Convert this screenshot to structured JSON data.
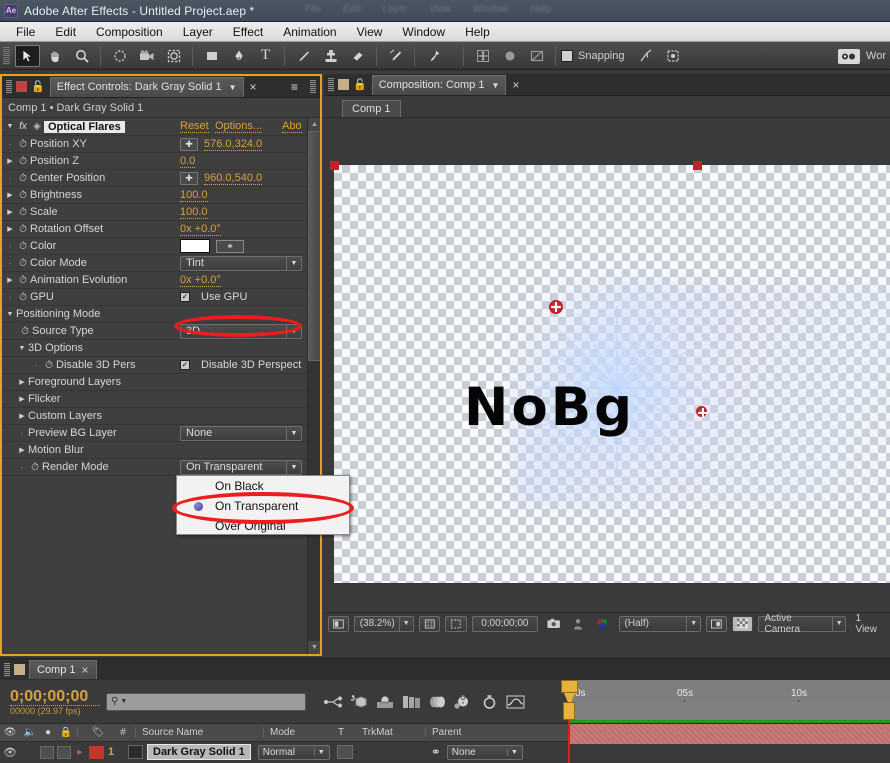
{
  "window": {
    "app_badge": "Ae",
    "title": "Adobe After Effects - Untitled Project.aep *",
    "ghost_menu": [
      "File",
      "Edit",
      "Composition",
      "Layer",
      "Effect",
      "Animation",
      "View",
      "Window",
      "Help"
    ]
  },
  "menubar": {
    "items": [
      "File",
      "Edit",
      "Composition",
      "Layer",
      "Effect",
      "Animation",
      "View",
      "Window",
      "Help"
    ]
  },
  "toolbar": {
    "tools": [
      {
        "name": "selection-tool",
        "glyph": "➤",
        "active": true
      },
      {
        "name": "hand-tool",
        "glyph": "✋",
        "active": false
      },
      {
        "name": "zoom-tool",
        "glyph": "⌕",
        "active": false
      },
      {
        "name": "rotation-tool",
        "glyph": "◌",
        "active": false
      },
      {
        "name": "camera-tool",
        "glyph": "🎥",
        "active": false
      },
      {
        "name": "pan-behind-tool",
        "glyph": "⬚",
        "active": false
      },
      {
        "name": "shape-tool",
        "glyph": "■",
        "active": false
      },
      {
        "name": "pen-tool",
        "glyph": "✒",
        "active": false
      },
      {
        "name": "text-tool",
        "glyph": "T",
        "active": false
      },
      {
        "name": "brush-tool",
        "glyph": "╱",
        "active": false
      },
      {
        "name": "clone-stamp-tool",
        "glyph": "⚓",
        "active": false
      },
      {
        "name": "eraser-tool",
        "glyph": "▱",
        "active": false
      },
      {
        "name": "roto-brush-tool",
        "glyph": "✒",
        "active": false
      },
      {
        "name": "puppet-pin-tool",
        "glyph": "📌",
        "active": false
      }
    ],
    "axis_tools": [
      {
        "name": "anchor-point-tool",
        "glyph": "✥"
      },
      {
        "name": "orbit-tool",
        "glyph": "●"
      },
      {
        "name": "track-camera-tool",
        "glyph": "◨"
      }
    ],
    "snapping_label": "Snapping",
    "snapping_checked": false,
    "snap_icons": [
      {
        "name": "snap-align-icon",
        "glyph": "↗"
      },
      {
        "name": "snap-bounds-icon",
        "glyph": "⧉"
      }
    ],
    "workspace_label": "Wor"
  },
  "effect_controls": {
    "tab_title": "Effect Controls: Dark Gray Solid 1",
    "close_glyph": "×",
    "menu_glyph": "≡",
    "breadcrumb": "Comp 1 • Dark Gray Solid 1",
    "effect_name": "Optical Flares",
    "header_links": [
      "Reset",
      "Options...",
      "Abo"
    ],
    "properties": [
      {
        "name": "Position XY",
        "type": "point",
        "value": "576.0,324.0",
        "indent": 0,
        "twirl": "none",
        "stopwatch": true
      },
      {
        "name": "Position Z",
        "type": "number",
        "value": "0.0",
        "indent": 0,
        "twirl": "closed",
        "stopwatch": true
      },
      {
        "name": "Center Position",
        "type": "point",
        "value": "960.0,540.0",
        "indent": 0,
        "twirl": "none",
        "stopwatch": true
      },
      {
        "name": "Brightness",
        "type": "number",
        "value": "100.0",
        "indent": 0,
        "twirl": "closed",
        "stopwatch": true
      },
      {
        "name": "Scale",
        "type": "number",
        "value": "100.0",
        "indent": 0,
        "twirl": "closed",
        "stopwatch": true
      },
      {
        "name": "Rotation Offset",
        "type": "number",
        "value": "0x +0.0°",
        "indent": 0,
        "twirl": "closed",
        "stopwatch": true
      },
      {
        "name": "Color",
        "type": "color",
        "value": "#ffffff",
        "indent": 0,
        "twirl": "none",
        "stopwatch": true
      },
      {
        "name": "Color Mode",
        "type": "dropdown",
        "value": "Tint",
        "indent": 0,
        "twirl": "none",
        "stopwatch": true
      },
      {
        "name": "Animation Evolution",
        "type": "number",
        "value": "0x +0.0°",
        "indent": 0,
        "twirl": "closed",
        "stopwatch": true
      },
      {
        "name": "GPU",
        "type": "checkbox",
        "value": "Use GPU",
        "checked": true,
        "indent": 0,
        "twirl": "none",
        "stopwatch": true
      },
      {
        "name": "Positioning Mode",
        "type": "group",
        "value": "",
        "indent": 0,
        "twirl": "open",
        "stopwatch": false
      },
      {
        "name": "Source Type",
        "type": "dropdown",
        "value": "3D",
        "indent": 1,
        "twirl": "none",
        "stopwatch": true,
        "highlighted": true
      },
      {
        "name": "3D Options",
        "type": "group",
        "value": "",
        "indent": 1,
        "twirl": "open",
        "stopwatch": false
      },
      {
        "name": "Disable 3D Pers",
        "type": "checkbox",
        "value": "Disable 3D Perspect",
        "checked": true,
        "indent": 2,
        "twirl": "none",
        "stopwatch": true
      },
      {
        "name": "Foreground Layers",
        "type": "group",
        "value": "",
        "indent": 0,
        "twirl": "closed",
        "stopwatch": false
      },
      {
        "name": "Flicker",
        "type": "group",
        "value": "",
        "indent": 0,
        "twirl": "closed",
        "stopwatch": false
      },
      {
        "name": "Custom Layers",
        "type": "group",
        "value": "",
        "indent": 0,
        "twirl": "closed",
        "stopwatch": false
      },
      {
        "name": "Preview BG Layer",
        "type": "dropdown",
        "value": "None",
        "indent": 0,
        "twirl": "none",
        "stopwatch": false
      },
      {
        "name": "Motion Blur",
        "type": "group",
        "value": "",
        "indent": 0,
        "twirl": "closed",
        "stopwatch": false
      },
      {
        "name": "Render Mode",
        "type": "dropdown",
        "value": "On Transparent",
        "indent": 0,
        "twirl": "none",
        "stopwatch": true
      }
    ]
  },
  "render_mode_popup": {
    "options": [
      "On Black",
      "On Transparent",
      "Over Original"
    ],
    "selected": "On Transparent"
  },
  "annotations": {
    "highlight_color": "#ee1c1c",
    "targets": [
      "source-type-dropdown",
      "render-mode-on-transparent-option"
    ]
  },
  "composition": {
    "tab_title": "Composition: Comp 1",
    "close_glyph": "×",
    "sub_tab": "Comp 1",
    "canvas_text": "NoBg",
    "bottom_bar": {
      "region_of_interest_icon": "▣",
      "zoom_level": "(38.2%)",
      "grid_icon": "⌗",
      "mask_icon": "⬚",
      "timecode": "0;00;00;00",
      "snapshot_icon": "📷",
      "show_snapshot_icon": "♟",
      "channel_icon": "◑",
      "resolution": "(Half)",
      "region_icon": "□",
      "transparency_grid_icon": "▒",
      "camera_view": "Active Camera",
      "view_layout": "1 View"
    }
  },
  "timeline": {
    "tab_title": "Comp 1",
    "close_glyph": "×",
    "current_time": "0;00;00;00",
    "frame_info": "00000 (29.97 fps)",
    "search_placeholder": "",
    "toolbar_icons": [
      {
        "name": "composition-mini-flowchart-icon",
        "glyph": "⇉"
      },
      {
        "name": "draft-3d-icon",
        "glyph": "⬡"
      },
      {
        "name": "hide-shy-layers-icon",
        "glyph": "☂"
      },
      {
        "name": "frame-blending-icon",
        "glyph": "▓"
      },
      {
        "name": "motion-blur-icon",
        "glyph": "◐"
      },
      {
        "name": "brainstorm-icon",
        "glyph": "☀"
      },
      {
        "name": "auto-keyframe-icon",
        "glyph": "⏱"
      },
      {
        "name": "graph-editor-icon",
        "glyph": "⌀"
      }
    ],
    "column_headers": [
      "#",
      "Source Name",
      "Mode",
      "T",
      "TrkMat",
      "Parent"
    ],
    "switch_icons": [
      {
        "name": "video-visibility-icon",
        "glyph": "◉"
      },
      {
        "name": "audio-icon",
        "glyph": "◄"
      },
      {
        "name": "solo-icon",
        "glyph": "●"
      },
      {
        "name": "lock-icon",
        "glyph": "🔒"
      },
      {
        "name": "label-icon",
        "glyph": "◆"
      }
    ],
    "layers": [
      {
        "index": "1",
        "source_name": "Dark Gray Solid 1",
        "mode": "Normal",
        "trkmat": "",
        "parent": "None",
        "label_color": "#c0392b",
        "visible": true
      }
    ],
    "ruler_ticks": [
      "0s",
      "05s",
      "10s"
    ]
  }
}
